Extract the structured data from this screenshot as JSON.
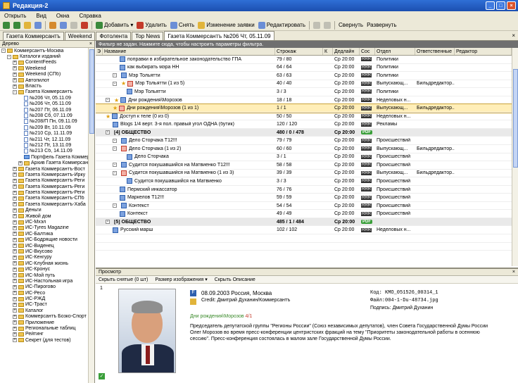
{
  "window": {
    "title": "Редакция-2"
  },
  "menu": [
    "Открыть",
    "Вид",
    "Окна",
    "Справка"
  ],
  "toolbar": {
    "add": "Добавить",
    "delete": "Удалить",
    "remove": "Снять",
    "change": "Изменение заявки",
    "edit": "Редактировать",
    "collapse": "Свернуть",
    "expand": "Развернуть"
  },
  "tabs": [
    "Газета Коммерсантъ",
    "Weekend",
    "Фотолента",
    "Top News",
    "Газета Коммерсантъ №206 Чт, 05.11.09"
  ],
  "tree": {
    "title": "Дерево",
    "items": [
      {
        "label": "Коммерсантъ-Москва",
        "level": 0,
        "pm": "-",
        "icon": "folder"
      },
      {
        "label": "Каталоги изданий",
        "level": 1,
        "pm": "-",
        "icon": "folder"
      },
      {
        "label": "ContentFeeds",
        "level": 2,
        "pm": "+",
        "icon": "folder"
      },
      {
        "label": "Weekend",
        "level": 2,
        "pm": "+",
        "icon": "folder"
      },
      {
        "label": "Weekend (СПб)",
        "level": 2,
        "pm": "+",
        "icon": "folder"
      },
      {
        "label": "Автопилот",
        "level": 2,
        "pm": "+",
        "icon": "folder"
      },
      {
        "label": "Власть",
        "level": 2,
        "pm": "+",
        "icon": "folder"
      },
      {
        "label": "Газета Коммерсантъ",
        "level": 2,
        "pm": "-",
        "icon": "folder"
      },
      {
        "label": "№206 Чт, 05.11.09",
        "level": 3,
        "pm": "",
        "icon": "doc"
      },
      {
        "label": "№206 Чт, 05.11.09",
        "level": 3,
        "pm": "",
        "icon": "doc"
      },
      {
        "label": "№207 Пт, 06.11.09",
        "level": 3,
        "pm": "",
        "icon": "doc"
      },
      {
        "label": "№208 Сб, 07.11.09",
        "level": 3,
        "pm": "",
        "icon": "doc"
      },
      {
        "label": "№208/П Пн, 09.11.09",
        "level": 3,
        "pm": "",
        "icon": "doc"
      },
      {
        "label": "№209 Вт, 10.11.09",
        "level": 3,
        "pm": "",
        "icon": "doc"
      },
      {
        "label": "№210 Ср, 11.11.09",
        "level": 3,
        "pm": "",
        "icon": "doc"
      },
      {
        "label": "№211 Чт, 12.11.09",
        "level": 3,
        "pm": "",
        "icon": "doc"
      },
      {
        "label": "№212 Пт, 13.11.09",
        "level": 3,
        "pm": "",
        "icon": "doc"
      },
      {
        "label": "№213 Сб, 14.11.09",
        "level": 3,
        "pm": "",
        "icon": "doc"
      },
      {
        "label": "Портфель Газета Коммерса",
        "level": 3,
        "pm": "",
        "icon": "blue"
      },
      {
        "label": "Архив Газета Коммерсантъ",
        "level": 3,
        "pm": "+",
        "icon": "folder"
      },
      {
        "label": "Газета Коммерсантъ-Вост",
        "level": 2,
        "pm": "+",
        "icon": "folder"
      },
      {
        "label": "Газета Коммерсантъ-Ирку",
        "level": 2,
        "pm": "+",
        "icon": "folder"
      },
      {
        "label": "Газета Коммерсантъ-Реги",
        "level": 2,
        "pm": "+",
        "icon": "folder"
      },
      {
        "label": "Газета Коммерсантъ-Реги",
        "level": 2,
        "pm": "+",
        "icon": "folder"
      },
      {
        "label": "Газета Коммерсантъ-Реги",
        "level": 2,
        "pm": "+",
        "icon": "folder"
      },
      {
        "label": "Газета Коммерсантъ-СПб",
        "level": 2,
        "pm": "+",
        "icon": "folder"
      },
      {
        "label": "Газета Коммерсантъ-Хаба",
        "level": 2,
        "pm": "+",
        "icon": "folder"
      },
      {
        "label": "Деньги",
        "level": 2,
        "pm": "+",
        "icon": "folder"
      },
      {
        "label": "Живой дом",
        "level": 2,
        "pm": "+",
        "icon": "folder"
      },
      {
        "label": "ИС-Мхэл",
        "level": 2,
        "pm": "+",
        "icon": "folder"
      },
      {
        "label": "ИС-Tyres Magazine",
        "level": 2,
        "pm": "+",
        "icon": "folder"
      },
      {
        "label": "ИС-Балтика",
        "level": 2,
        "pm": "+",
        "icon": "folder"
      },
      {
        "label": "ИС-Бодрящие новости",
        "level": 2,
        "pm": "+",
        "icon": "folder"
      },
      {
        "label": "ИС-Виденец",
        "level": 2,
        "pm": "+",
        "icon": "folder"
      },
      {
        "label": "ИС-Вкусово",
        "level": 2,
        "pm": "+",
        "icon": "folder"
      },
      {
        "label": "ИС-Кенгуру",
        "level": 2,
        "pm": "+",
        "icon": "folder"
      },
      {
        "label": "ИС-Клубная жизнь",
        "level": 2,
        "pm": "+",
        "icon": "folder"
      },
      {
        "label": "ИС-Кронус",
        "level": 2,
        "pm": "+",
        "icon": "folder"
      },
      {
        "label": "ИС-Мой путь",
        "level": 2,
        "pm": "+",
        "icon": "folder"
      },
      {
        "label": "ИС-Настольная игра",
        "level": 2,
        "pm": "+",
        "icon": "folder"
      },
      {
        "label": "ИС-Пирогово",
        "level": 2,
        "pm": "+",
        "icon": "folder"
      },
      {
        "label": "ИС-Ресо",
        "level": 2,
        "pm": "+",
        "icon": "folder"
      },
      {
        "label": "ИС-РЖД",
        "level": 2,
        "pm": "+",
        "icon": "folder"
      },
      {
        "label": "ИС-Траст",
        "level": 2,
        "pm": "+",
        "icon": "folder"
      },
      {
        "label": "Каталог",
        "level": 2,
        "pm": "+",
        "icon": "folder"
      },
      {
        "label": "Коммерсантъ Бозко-Спорт",
        "level": 2,
        "pm": "+",
        "icon": "folder"
      },
      {
        "label": "Приложение",
        "level": 2,
        "pm": "+",
        "icon": "folder"
      },
      {
        "label": "Региональные таблиц",
        "level": 2,
        "pm": "+",
        "icon": "folder"
      },
      {
        "label": "Рейтинг",
        "level": 2,
        "pm": "+",
        "icon": "folder"
      },
      {
        "label": "Секрет (для тестов)",
        "level": 2,
        "pm": "+",
        "icon": "folder"
      }
    ]
  },
  "filter": "Фильтр не задан. Нажмите сюда, чтобы настроить параметры фильтра.",
  "grid": {
    "headers": [
      "Э",
      "Название",
      "Строкаж",
      "К",
      "Дедлайн",
      "Сос",
      "Отдел",
      "Ответственные",
      "Редактор"
    ],
    "rows": [
      {
        "pm": "",
        "ind": 2,
        "star": false,
        "icon": "doc",
        "name": "поправки в избирательное законодательство ГПА",
        "str": "79 / 80",
        "dl": "Ср 20:00",
        "s": "RRR",
        "dept": "Политики",
        "resp": ""
      },
      {
        "pm": "",
        "ind": 2,
        "star": false,
        "icon": "doc",
        "name": "как выбирать мэра НН",
        "str": "64 / 64",
        "dl": "Ср 20:00",
        "s": "RRR",
        "dept": "Политики",
        "resp": ""
      },
      {
        "pm": "-",
        "ind": 1,
        "star": false,
        "icon": "doc",
        "name": "Мэр Тольятти",
        "str": "63 / 63",
        "dl": "Ср 20:00",
        "s": "RRR",
        "dept": "Политики",
        "resp": ""
      },
      {
        "pm": "-",
        "ind": 1,
        "star": true,
        "icon": "r",
        "name": "Мэр Тольятти (1 из 5)",
        "str": "40 / 40",
        "dl": "Ср 20:00",
        "s": "RRR",
        "dept": "Выпускающ...",
        "resp": "Бильдредактор..."
      },
      {
        "pm": "",
        "ind": 3,
        "star": false,
        "icon": "doc",
        "name": "Мэр Тольятти",
        "str": "3 / 3",
        "dl": "Ср 20:00",
        "s": "RRR",
        "dept": "Политики",
        "resp": ""
      },
      {
        "pm": "-",
        "ind": 0,
        "star": true,
        "icon": "doc",
        "name": "Дни рождения\\Морозов",
        "str": "18 / 18",
        "dl": "Ср 20:00",
        "s": "RRR",
        "dept": "Неделовых н...",
        "resp": ""
      },
      {
        "pm": "",
        "ind": 1,
        "star": true,
        "icon": "r",
        "name": "Дни рождения\\Морозов (1 из 1)",
        "str": "1 / 1",
        "dl": "Ср 20:00",
        "s": "RRR",
        "dept": "Выпускающ...",
        "resp": "Бильдредактор...",
        "sel": true
      },
      {
        "pm": "",
        "ind": 0,
        "star": true,
        "icon": "doc",
        "name": "Доступ к теле (0 из 0)",
        "str": "50 / 50",
        "dl": "Ср 20:00",
        "s": "RRR",
        "dept": "Неделовых н...",
        "resp": ""
      },
      {
        "pm": "",
        "ind": 1,
        "star": false,
        "icon": "doc",
        "name": "Blogs 1/4 верт. 3-я пол. правый угол ОДНА (бутик)",
        "str": "120 / 120",
        "dl": "Ср 20:00",
        "s": "RRR",
        "dept": "Рекламы",
        "resp": ""
      },
      {
        "group": true,
        "pm": "-",
        "name": "[4] ОБЩЕСТВО",
        "str": "480 / 0 / 478",
        "dl": "Ср 20:00",
        "s": "PDF"
      },
      {
        "pm": "-",
        "ind": 1,
        "star": false,
        "icon": "doc",
        "name": "Дело Сторчака Т12!!!",
        "str": "79 / 79",
        "dl": "Ср 20:00",
        "s": "RRR",
        "dept": "Происшествий",
        "resp": ""
      },
      {
        "pm": "-",
        "ind": 1,
        "star": false,
        "icon": "r",
        "name": "Дело Сторчака (1 из 2)",
        "str": "60 / 60",
        "dl": "Ср 20:00",
        "s": "RRR",
        "dept": "Выпускающ...",
        "resp": "Бильдредактор..."
      },
      {
        "pm": "",
        "ind": 3,
        "star": false,
        "icon": "doc",
        "name": "Дело Сторчака",
        "str": "3 / 1",
        "dl": "Ср 20:00",
        "s": "RRR",
        "dept": "Происшествий",
        "resp": ""
      },
      {
        "pm": "-",
        "ind": 1,
        "star": false,
        "icon": "doc",
        "name": "Судится покушавшийся на Матвиенко Т12!!!",
        "str": "58 / 58",
        "dl": "Ср 20:00",
        "s": "RRR",
        "dept": "Происшествий",
        "resp": ""
      },
      {
        "pm": "-",
        "ind": 1,
        "star": false,
        "icon": "r",
        "name": "Судится покушавшийся на Матвиенко (1 из 3)",
        "str": "39 / 39",
        "dl": "Ср 20:00",
        "s": "RRR",
        "dept": "Выпускающ...",
        "resp": "Бильдредактор..."
      },
      {
        "pm": "",
        "ind": 3,
        "star": false,
        "icon": "doc",
        "name": "Судится покушавшийся на Матвиенко",
        "str": "3 / 3",
        "dl": "Ср 20:00",
        "s": "RRR",
        "dept": "Происшествий",
        "resp": ""
      },
      {
        "pm": "",
        "ind": 2,
        "star": false,
        "icon": "doc",
        "name": "Пермский инкассатор",
        "str": "76 / 76",
        "dl": "Ср 20:00",
        "s": "RRR",
        "dept": "Происшествий",
        "resp": ""
      },
      {
        "pm": "",
        "ind": 2,
        "star": false,
        "icon": "doc",
        "name": "Маркелов Т12!!!",
        "str": "59 / 59",
        "dl": "Ср 20:00",
        "s": "RRR",
        "dept": "Происшествий",
        "resp": ""
      },
      {
        "pm": "-",
        "ind": 1,
        "star": false,
        "icon": "doc",
        "name": "Контекст",
        "str": "54 / 54",
        "dl": "Ср 20:00",
        "s": "RRR",
        "dept": "Происшествий",
        "resp": ""
      },
      {
        "pm": "",
        "ind": 2,
        "star": false,
        "icon": "doc",
        "name": "Контекст",
        "str": "49 / 49",
        "dl": "Ср 20:00",
        "s": "RRR",
        "dept": "Происшествий",
        "resp": ""
      },
      {
        "group": true,
        "pm": "-",
        "name": "[5] ОБЩЕСТВО",
        "str": "485 / 1 / 484",
        "dl": "Ср 20:00",
        "s": "PDF"
      },
      {
        "pm": "",
        "ind": 1,
        "star": false,
        "icon": "doc",
        "name": "Русский марш",
        "str": "102 / 102",
        "dl": "Ср 20:00",
        "s": "RRR",
        "dept": "Неделовых н...",
        "resp": ""
      },
      {
        "pm": "",
        "ind": 1,
        "star": false,
        "icon": "doc",
        "name": "",
        "str": "",
        "dl": "",
        "s": "",
        "dept": "",
        "resp": ""
      },
      {
        "pm": "",
        "ind": 1,
        "star": false,
        "icon": "doc",
        "name": "",
        "str": "",
        "dl": "",
        "s": "",
        "dept": "",
        "resp": ""
      }
    ]
  },
  "preview": {
    "title": "Просмотр",
    "btn_hide": "Скрыть снятые (0 шт)",
    "btn_size": "Размер изображения",
    "btn_desc": "Скрыть Описание",
    "index": "1",
    "date_place": "08.09.2003 Россия, Москва",
    "credit": "Credit: Дмитрий Духанин/Коммерсантъ",
    "code": "Код:  KMO_051526_00314_1",
    "file": "Файл:004-1-Du-48734.jpg",
    "signature": "Подпись: Дмитрий Духанин",
    "link": "Дни рождения\\Морозов",
    "link_count": "4/1",
    "desc1": "Председатель депутатской группы \"Регионы России\" (Союз независимых депутатов), член Совета Государственной Думы России",
    "desc2": "Олег Морозов во время пресс-конференции центристских фракций на тему \"Приоритеты законодательной работы в осеннюю",
    "desc3": "сессию\". Пресс-конференция состоялась в малом зале Государственной Думы России."
  }
}
